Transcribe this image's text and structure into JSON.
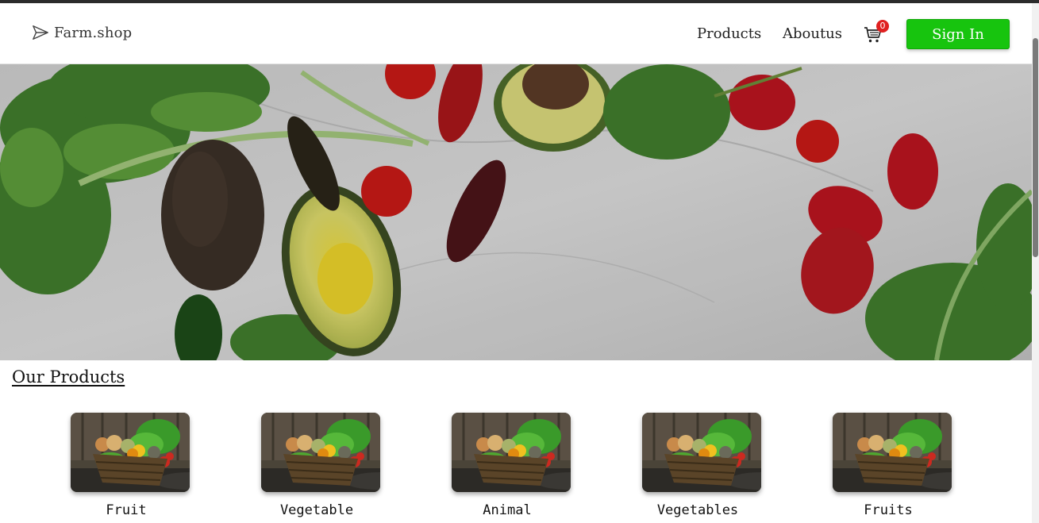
{
  "navbar": {
    "brand": {
      "icon": "paper-plane-icon",
      "name": "Farm.shop"
    },
    "links": [
      {
        "label": "Products"
      },
      {
        "label": "Aboutus"
      }
    ],
    "cart": {
      "icon": "cart-icon",
      "count": "0"
    },
    "signin_label": "Sign In",
    "signin_color": "#17c40e"
  },
  "hero": {
    "image": "vegetables-on-marble-photo"
  },
  "products": {
    "title": "Our Products",
    "items": [
      {
        "label": "Fruit",
        "image": "vegetable-basket-photo"
      },
      {
        "label": "Vegetable",
        "image": "vegetable-basket-photo"
      },
      {
        "label": "Animal",
        "image": "vegetable-basket-photo"
      },
      {
        "label": "Vegetables",
        "image": "vegetable-basket-photo"
      },
      {
        "label": "Fruits",
        "image": "vegetable-basket-photo"
      }
    ]
  }
}
